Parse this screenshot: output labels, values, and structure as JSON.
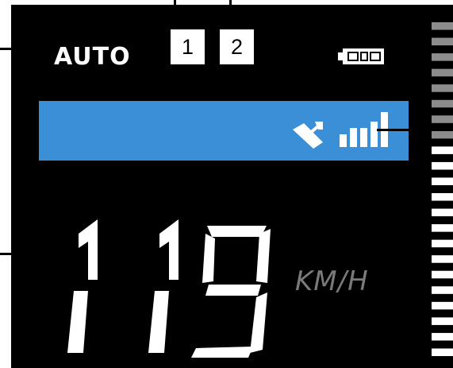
{
  "mode_label": "AUTO",
  "mode_boxes": [
    "1",
    "2"
  ],
  "speed_value": "119",
  "speed_unit": "KM/H",
  "colors": {
    "screen": "#000000",
    "banner": "#3a8fd6",
    "text": "#ffffff",
    "unit_text": "#7a7a7a",
    "bars_dim": "#8c8c8c",
    "bars_bright": "#ffffff"
  },
  "icons": {
    "battery": "battery-icon",
    "satellite": "satellite-dish-icon",
    "signal": "signal-strength-icon"
  },
  "level_bars": {
    "count": 22,
    "dim_count": 8
  }
}
